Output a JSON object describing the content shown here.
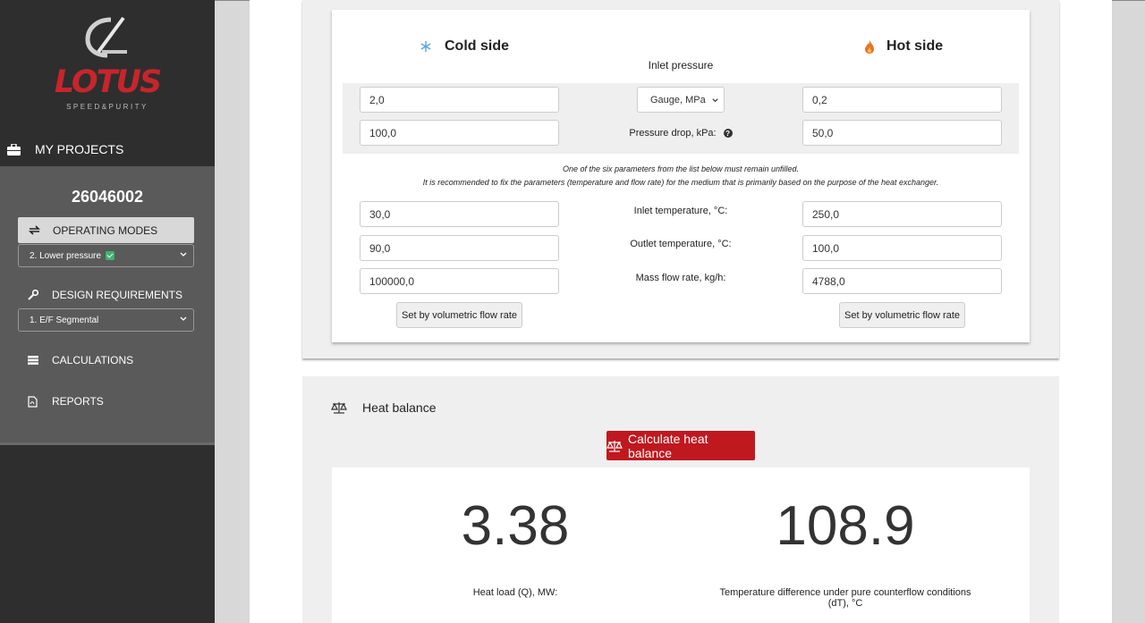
{
  "brand": {
    "name": "LOTUS",
    "tagline": "SPEED&PURITY"
  },
  "sidebar": {
    "my_projects": "MY PROJECTS",
    "project_code": "26046002",
    "operating_modes": "OPERATING MODES",
    "mode_select": "2. Lower pressure",
    "design_requirements": "DESIGN REQUIREMENTS",
    "design_select": "1. E/F Segmental",
    "calculations": "CALCULATIONS",
    "reports": "REPORTS"
  },
  "form": {
    "cold_side_title": "Cold side",
    "hot_side_title": "Hot side",
    "inlet_pressure_label": "Inlet pressure",
    "cold_inlet_pressure": "2,0",
    "pressure_unit": "Gauge, MPa",
    "hot_inlet_pressure": "0,2",
    "cold_pressure_drop": "100,0",
    "pressure_drop_label": "Pressure drop, kPa:",
    "hot_pressure_drop": "50,0",
    "note_line1": "One of the six parameters from the list below must remain unfilled.",
    "note_line2": "It is recommended to fix the parameters (temperature and flow rate) for the medium that is primarily based on the purpose of the heat exchanger.",
    "cold_inlet_temp": "30,0",
    "inlet_temp_label": "Inlet temperature, °C:",
    "hot_inlet_temp": "250,0",
    "cold_outlet_temp": "90,0",
    "outlet_temp_label": "Outlet temperature, °C:",
    "hot_outlet_temp": "100,0",
    "cold_mass_flow": "100000,0",
    "mass_flow_label": "Mass flow rate, kg/h:",
    "hot_mass_flow": "4788,0",
    "volumetric_button": "Set by volumetric flow rate"
  },
  "heat_balance": {
    "title": "Heat balance",
    "calculate_button": "Calculate heat balance",
    "heat_load_value": "3.38",
    "heat_load_label": "Heat load (Q), MW:",
    "dt_value": "108.9",
    "dt_label": "Temperature difference under pure counterflow conditions (dT), °C"
  },
  "colors": {
    "accent": "#c0181f",
    "sidebar": "#2e2e2e",
    "panel": "#5a5a5a"
  }
}
